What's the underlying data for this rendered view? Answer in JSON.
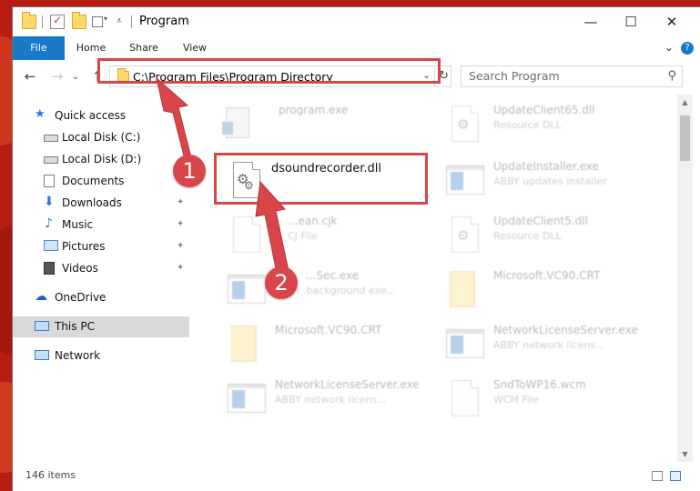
{
  "window": {
    "title": "Program",
    "controls": {
      "minimize": "—",
      "maximize": "☐",
      "close": "✕"
    }
  },
  "ribbon": {
    "tabs": [
      "File",
      "Home",
      "Share",
      "View"
    ],
    "expand_glyph": "⌄",
    "help_glyph": "?"
  },
  "address": {
    "path": "C:\\Program Files\\Program Directory",
    "dropdown_glyph": "⌄",
    "refresh_glyph": "↻"
  },
  "nav_glyphs": {
    "back": "←",
    "forward": "→",
    "recent": "⌄",
    "up": "↑"
  },
  "search": {
    "placeholder": "Search Program",
    "icon_glyph": "⚲"
  },
  "sidebar": {
    "items": [
      {
        "label": "Quick access",
        "icon": "star-icon",
        "pinned": false
      },
      {
        "label": "Local Disk (C:)",
        "icon": "drive-icon",
        "pinned": true
      },
      {
        "label": "Local Disk (D:)",
        "icon": "drive-icon",
        "pinned": true
      },
      {
        "label": "Documents",
        "icon": "documents-icon",
        "pinned": true
      },
      {
        "label": "Downloads",
        "icon": "download-arrow-icon",
        "pinned": true
      },
      {
        "label": "Music",
        "icon": "music-note-icon",
        "pinned": true
      },
      {
        "label": "Pictures",
        "icon": "pictures-icon",
        "pinned": true
      },
      {
        "label": "Videos",
        "icon": "film-icon",
        "pinned": true
      },
      {
        "label": "OneDrive",
        "icon": "cloud-icon",
        "pinned": false
      },
      {
        "label": "This PC",
        "icon": "monitor-icon",
        "pinned": false,
        "selected": true
      },
      {
        "label": "Network",
        "icon": "network-icon",
        "pinned": false
      }
    ],
    "pin_glyph": "📌"
  },
  "files": {
    "program_exe": {
      "name": "program.exe",
      "type": ""
    },
    "update_client65": {
      "name": "UpdateClient65.dll",
      "type": "Resource DLL"
    },
    "dsoundrecorder": {
      "name": "dsoundrecorder.dll",
      "type": ""
    },
    "update_installer": {
      "name": "UpdateInstaller.exe",
      "type": "ABBY updates installer"
    },
    "clean": {
      "name": "...ean.cjk",
      "type": "CJ File"
    },
    "update_client5": {
      "name": "UpdateClient5.dll",
      "type": "Resource DLL"
    },
    "sec_exe": {
      "name": "...Sec.exe",
      "type": "...background exe..."
    },
    "vc90_crt_right": {
      "name": "Microsoft.VC90.CRT",
      "type": ""
    },
    "vc90_crt_left": {
      "name": "Microsoft.VC90.CRT",
      "type": ""
    },
    "nls_right": {
      "name": "NetworkLicenseServer.exe",
      "type": "ABBY network licens..."
    },
    "nls_left": {
      "name": "NetworkLicenseServer.exe",
      "type": "ABBY network licens..."
    },
    "sndtowp16": {
      "name": "SndToWP16.wcm",
      "type": "WCM File"
    }
  },
  "callouts": {
    "one": "1",
    "two": "2"
  },
  "status": {
    "items_text": "146 items"
  },
  "scroll_arrows": {
    "up": "▲",
    "down": "▼"
  },
  "colors": {
    "accent": "#1979ca",
    "highlight": "#d9464a",
    "background": "#b81d12"
  }
}
